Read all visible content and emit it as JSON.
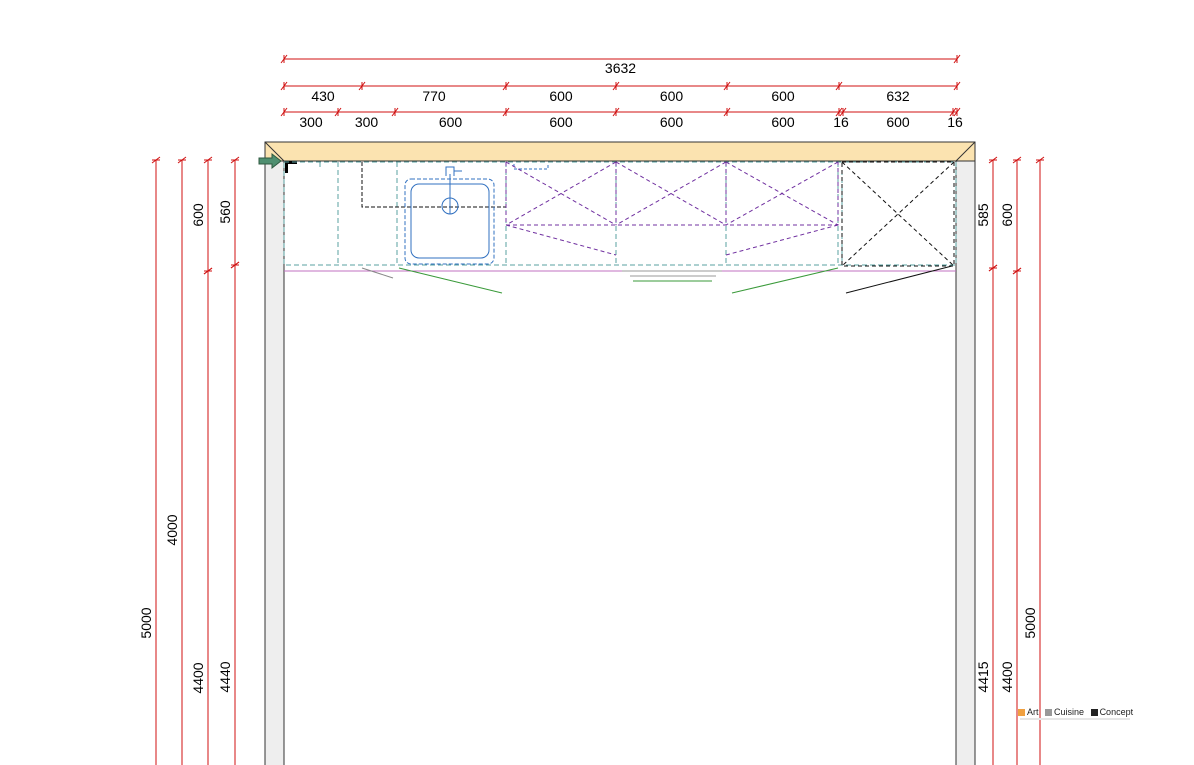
{
  "dimensions": {
    "overall_width": "3632",
    "row2": [
      "430",
      "770",
      "600",
      "600",
      "600",
      "632"
    ],
    "row3": [
      "300",
      "300",
      "600",
      "600",
      "600",
      "600",
      "16",
      "600",
      "16"
    ],
    "left_verticals": [
      "5000",
      "4000",
      "600",
      "4400",
      "560",
      "4440"
    ],
    "right_verticals": [
      "585",
      "4415",
      "600",
      "4400",
      "5000"
    ]
  },
  "logo": {
    "words": [
      "Art",
      "Cuisine",
      "Concept"
    ],
    "colors": [
      "#f0a040",
      "#999999",
      "#222222"
    ]
  },
  "colors": {
    "dimension_line": "#d01010",
    "wall_fill": "#eeeeee",
    "worktop_fill": "#fbe3b0",
    "cabinet_outline": "#5aa0a0",
    "wall_cabinet": "#7030a0",
    "sink": "#3070c0",
    "door_swing": "#3a9a3a",
    "tall_unit": "#111111",
    "arrow": "#2f7a5a"
  }
}
